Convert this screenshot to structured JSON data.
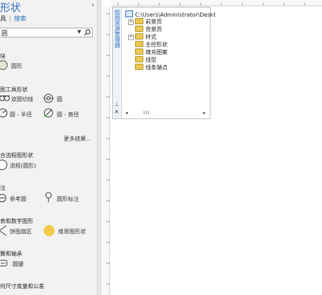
{
  "shapes_panel": {
    "title": "形状",
    "collapse_icon": "chevron-left",
    "tabs": [
      "具",
      "搜索"
    ],
    "search_value": "圆",
    "more_results": "更多结果...",
    "sections": [
      {
        "title": "块",
        "items": [
          {
            "label": "圆形"
          }
        ]
      },
      {
        "title": "图工具形状",
        "items": [
          {
            "label": "双圆切线"
          },
          {
            "label": "圆"
          },
          {
            "label": "圆 - 半径"
          },
          {
            "label": "圆 - 直径"
          }
        ]
      },
      {
        "title": "合流程图形状",
        "items": [
          {
            "label": "流程(圆形)"
          }
        ]
      },
      {
        "title": "注",
        "items": [
          {
            "label": "参考圆"
          },
          {
            "label": "圆形标注"
          }
        ]
      },
      {
        "title": "表和数字图形",
        "items": [
          {
            "label": "饼图扇区"
          },
          {
            "label": "维恩图形状"
          }
        ]
      },
      {
        "title": "簧和轴承",
        "items": [
          {
            "label": "圆键"
          }
        ]
      },
      {
        "title": "何尺寸度量和公差",
        "items": []
      }
    ]
  },
  "drawing_explorer": {
    "title": "绘图资源管理器",
    "root": "C:\\Users\\Administrator\\Deskt",
    "nodes": [
      "前景页",
      "背景页",
      "样式",
      "主控形状",
      "填充图案",
      "线型",
      "线条端点"
    ],
    "scroll_label": "III"
  },
  "colors": {
    "accent": "#2e6fbf",
    "folder": "#e9c954",
    "venn": "#f3c94a"
  }
}
